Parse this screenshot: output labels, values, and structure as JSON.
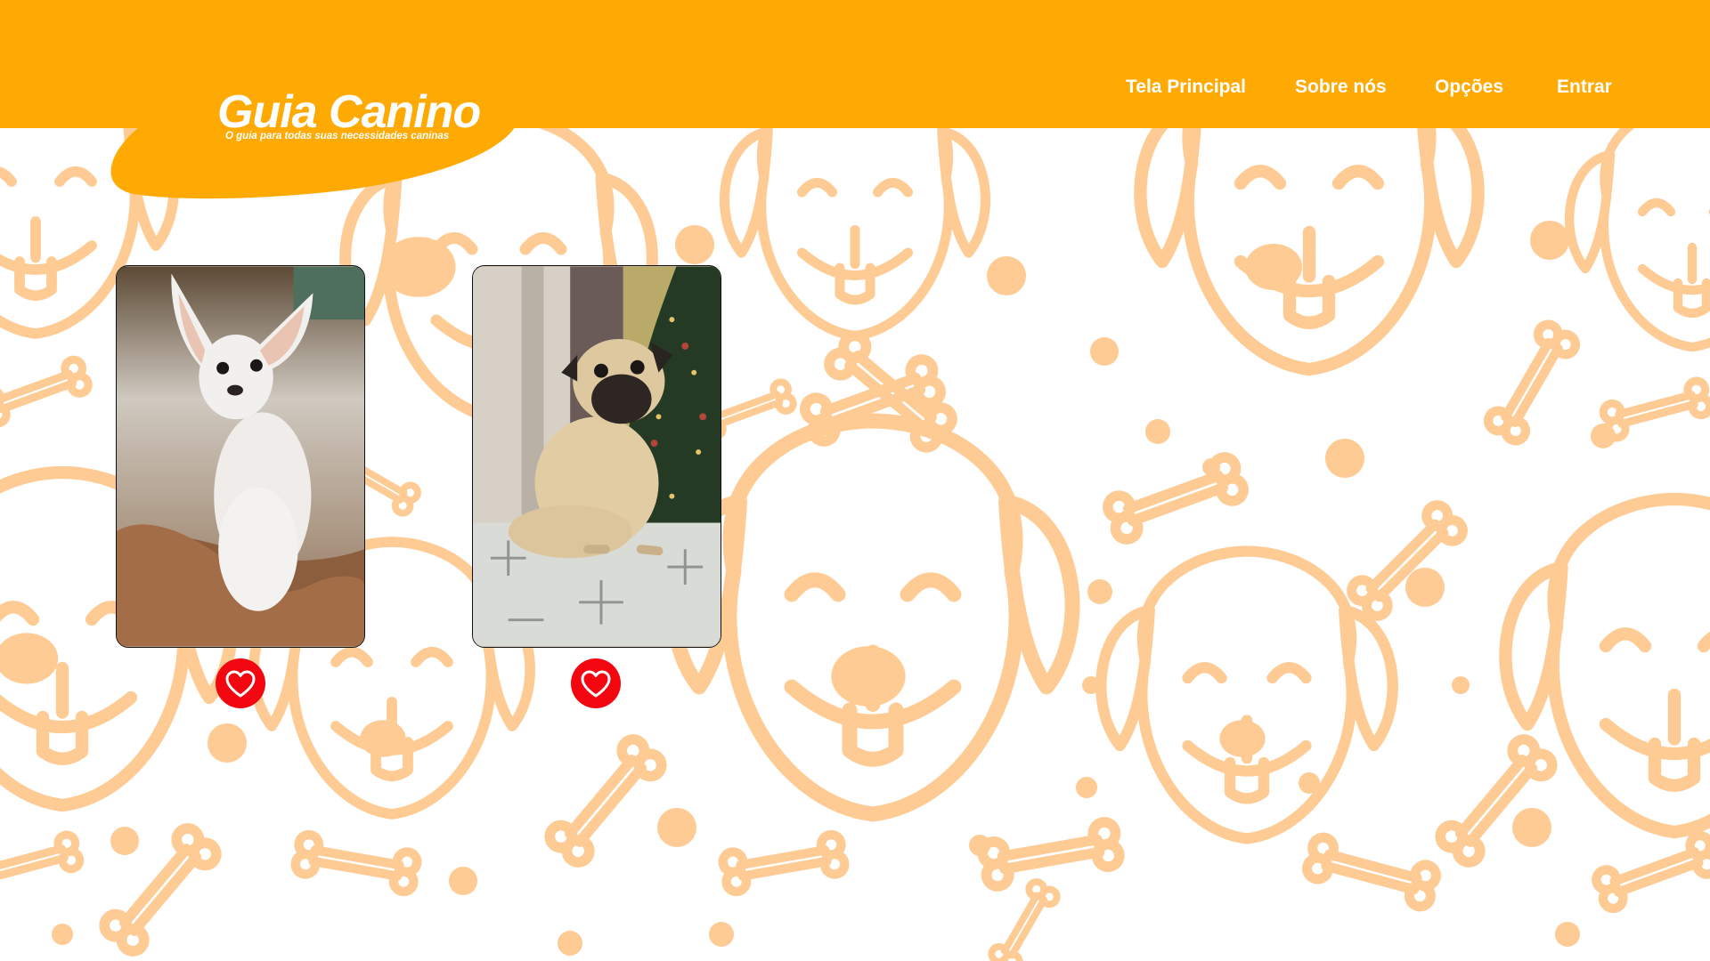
{
  "app": {
    "title": "Guia Canino",
    "tagline": "O guia para todas suas necessidades caninas"
  },
  "nav": {
    "items": [
      {
        "label": "Tela Principal"
      },
      {
        "label": "Sobre nós"
      },
      {
        "label": "Opções"
      },
      {
        "label": "Entrar"
      }
    ]
  },
  "gallery": {
    "cards": [
      {
        "subject": "white chihuahua photo",
        "liked_icon": "heart-icon"
      },
      {
        "subject": "pug photo",
        "liked_icon": "heart-icon"
      }
    ]
  },
  "colors": {
    "header": "#FFA903",
    "pattern": "#FDCB93",
    "like": "#F20610",
    "nav_text": "#FFFFFF"
  },
  "icons": [
    "dog-face-icon",
    "bone-icon",
    "heart-icon"
  ]
}
